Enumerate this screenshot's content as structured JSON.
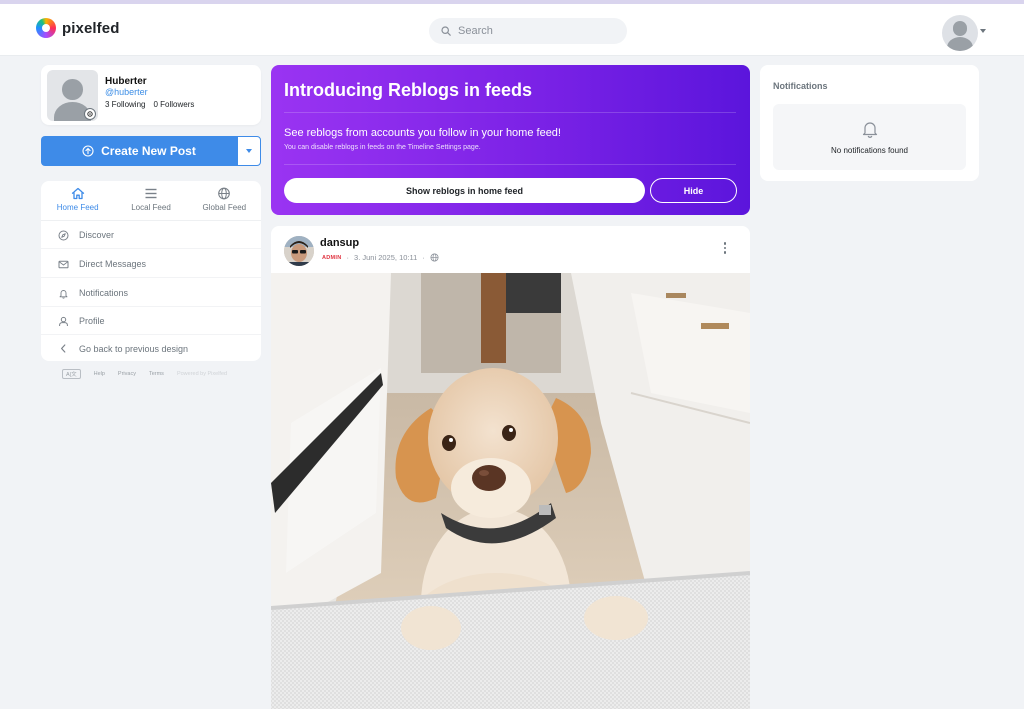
{
  "brand": {
    "name": "pixelfed"
  },
  "search": {
    "placeholder": "Search"
  },
  "profile": {
    "name": "Huberter",
    "handle": "@huberter",
    "following": "3 Following",
    "followers": "0 Followers"
  },
  "create_post": {
    "label": "Create New Post"
  },
  "feeds": [
    {
      "label": "Home Feed",
      "icon": "home-icon",
      "active": true
    },
    {
      "label": "Local Feed",
      "icon": "list-icon",
      "active": false
    },
    {
      "label": "Global Feed",
      "icon": "globe-icon",
      "active": false
    }
  ],
  "menu": [
    {
      "label": "Discover",
      "icon": "compass-icon"
    },
    {
      "label": "Direct Messages",
      "icon": "mail-icon"
    },
    {
      "label": "Notifications",
      "icon": "bell-icon"
    },
    {
      "label": "Profile",
      "icon": "user-icon"
    },
    {
      "label": "Go back to previous design",
      "icon": "chevron-left-icon"
    }
  ],
  "footer": {
    "lang": "A|文",
    "links": [
      "Help",
      "Privacy",
      "Terms"
    ],
    "powered": "Powered by Pixelfed"
  },
  "banner": {
    "title": "Introducing Reblogs in feeds",
    "text": "See reblogs from accounts you follow in your home feed!",
    "sub": "You can disable reblogs in feeds on the Timeline Settings page.",
    "show_label": "Show reblogs in home feed",
    "hide_label": "Hide"
  },
  "post": {
    "username": "dansup",
    "badge": "ADMIN",
    "timestamp": "3. Juni 2025, 10:11",
    "visibility_icon": "globe-icon"
  },
  "notifications": {
    "title": "Notifications",
    "empty": "No notifications found"
  },
  "colors": {
    "accent": "#3e8be8",
    "banner_start": "#9a34f2",
    "banner_end": "#5b15dc",
    "admin": "#e0323f"
  }
}
